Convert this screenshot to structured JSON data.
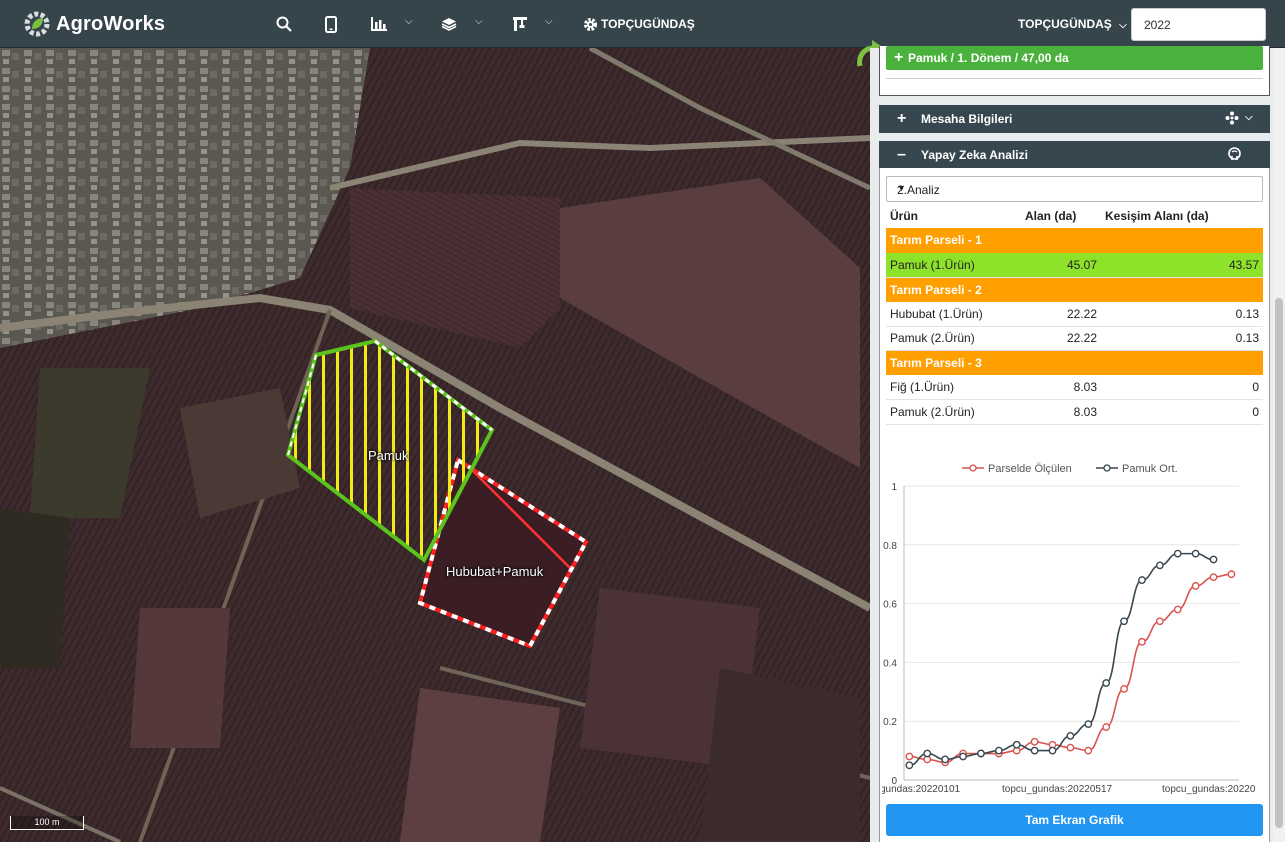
{
  "app": {
    "name": "AgroWorks",
    "farm_name": "TOPÇUGÜNDAŞ",
    "farm_dropdown": "TOPÇUGÜNDAŞ",
    "year": "2022"
  },
  "map": {
    "scale_label": "100 m",
    "parcel_labels": [
      "Pamuk",
      "Hububat+Pamuk"
    ]
  },
  "panel": {
    "crop_button": "Pamuk / 1. Dönem / 47,00 da",
    "sections": {
      "measurement": "Mesaha Bilgileri",
      "ai": "Yapay Zeka Analizi"
    },
    "analysis_select": "2.Analiz",
    "table": {
      "headers": [
        "Ürün",
        "Alan (da)",
        "Kesişim Alanı (da)"
      ],
      "groups": [
        {
          "title": "Tarım Parseli - 1",
          "rows": [
            {
              "crop": "Pamuk (1.Ürün)",
              "area": "45.07",
              "intersect": "43.57",
              "highlight": true
            }
          ]
        },
        {
          "title": "Tarım Parseli - 2",
          "rows": [
            {
              "crop": "Hububat (1.Ürün)",
              "area": "22.22",
              "intersect": "0.13"
            },
            {
              "crop": "Pamuk (2.Ürün)",
              "area": "22.22",
              "intersect": "0.13"
            }
          ]
        },
        {
          "title": "Tarım Parseli - 3",
          "rows": [
            {
              "crop": "Fiğ (1.Ürün)",
              "area": "8.03",
              "intersect": "0"
            },
            {
              "crop": "Pamuk (2.Ürün)",
              "area": "8.03",
              "intersect": "0"
            }
          ]
        }
      ]
    },
    "full_screen_button": "Tam Ekran Grafik"
  },
  "chart_data": {
    "type": "line",
    "ylim": [
      0,
      1
    ],
    "yticks": [
      "0",
      "0.2",
      "0.4",
      "0.6",
      "0.8",
      "1"
    ],
    "x_tick_labels": [
      "gundas:20220101",
      "topcu_gundas:20220517",
      "topcu_gundas:20220"
    ],
    "series": [
      {
        "name": "Parselde Ölçülen",
        "color": "#d9534f",
        "values": [
          0.08,
          0.07,
          0.06,
          0.09,
          0.09,
          0.09,
          0.1,
          0.13,
          0.12,
          0.11,
          0.1,
          0.18,
          0.31,
          0.47,
          0.54,
          0.58,
          0.66,
          0.69,
          0.7
        ]
      },
      {
        "name": "Pamuk Ort.",
        "color": "#37474f",
        "values": [
          0.05,
          0.09,
          0.07,
          0.08,
          0.09,
          0.1,
          0.12,
          0.1,
          0.1,
          0.15,
          0.19,
          0.33,
          0.54,
          0.68,
          0.73,
          0.77,
          0.77,
          0.75
        ]
      }
    ]
  }
}
